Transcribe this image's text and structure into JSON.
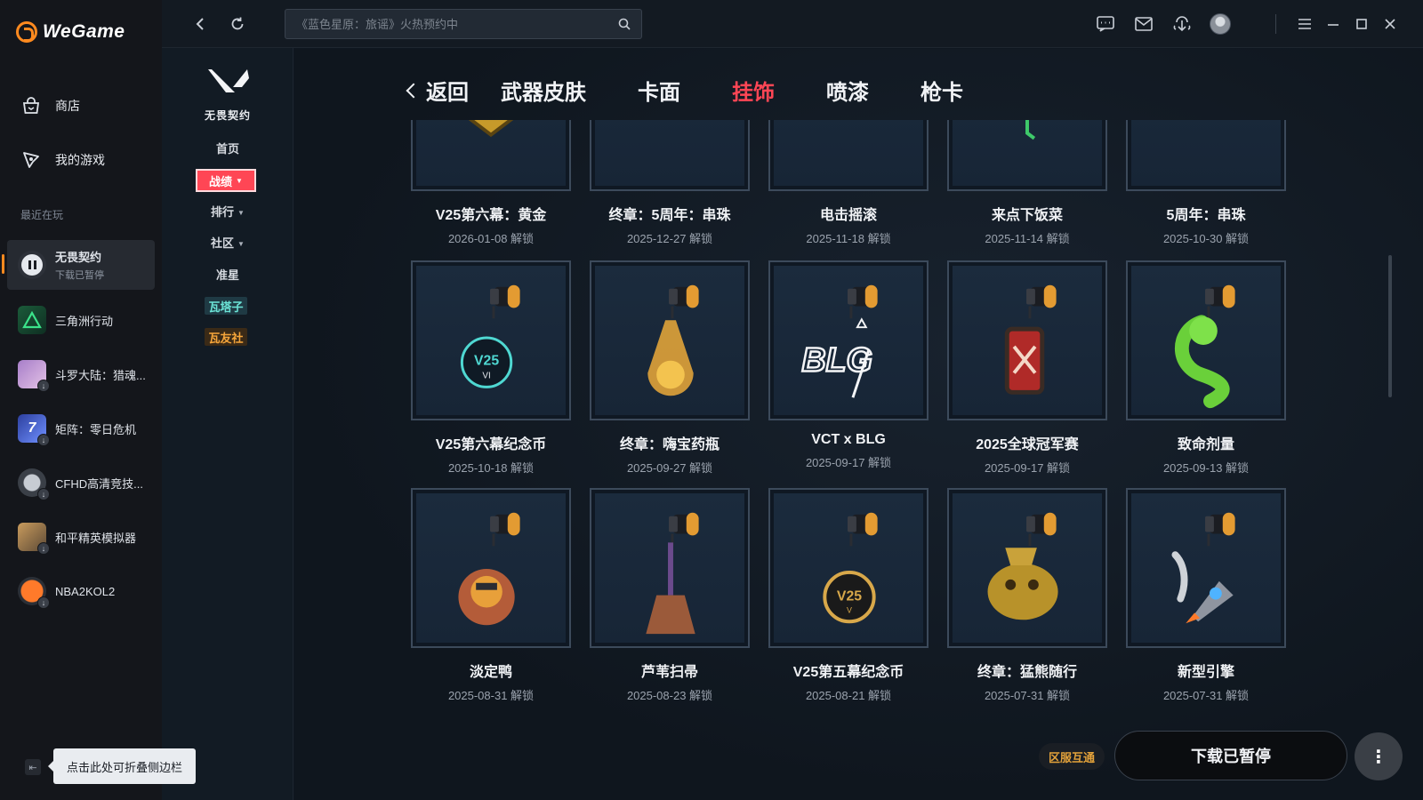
{
  "app": {
    "name": "WeGame"
  },
  "sidebar": {
    "nav": [
      {
        "label": "商店",
        "icon": "store-icon"
      },
      {
        "label": "我的游戏",
        "icon": "my-games-icon"
      }
    ],
    "recent_title": "最近在玩",
    "games": [
      {
        "name": "无畏契约",
        "sub": "下载已暂停",
        "active": true
      },
      {
        "name": "三角洲行动"
      },
      {
        "name": "斗罗大陆：猎魂..."
      },
      {
        "name": "矩阵：零日危机"
      },
      {
        "name": "CFHD高清竞技..."
      },
      {
        "name": "和平精英模拟器"
      },
      {
        "name": "NBA2KOL2"
      }
    ],
    "collapse_tooltip": "点击此处可折叠侧边栏"
  },
  "topbar": {
    "search_placeholder": "《蓝色星原：旅谣》火热预约中",
    "icons": [
      "chat-icon",
      "mail-icon",
      "download-manager-icon",
      "avatar",
      "menu-icon",
      "minimize-icon",
      "maximize-icon",
      "close-icon"
    ]
  },
  "game_nav": {
    "game_title": "无畏契约",
    "items": {
      "home": "首页",
      "record": "战绩",
      "rank": "排行",
      "community": "社区",
      "crosshair": "准星",
      "tag1": "瓦塔子",
      "tag2": "瓦友社"
    }
  },
  "tabs": {
    "back": "返回",
    "items": [
      {
        "label": "武器皮肤",
        "active": false
      },
      {
        "label": "卡面",
        "active": false
      },
      {
        "label": "挂饰",
        "active": true
      },
      {
        "label": "喷漆",
        "active": false
      },
      {
        "label": "枪卡",
        "active": false
      }
    ]
  },
  "unlock_suffix": "解锁",
  "items": [
    {
      "name": "V25第六幕：黄金",
      "date": "2026-01-08 解锁"
    },
    {
      "name": "终章：5周年：串珠",
      "date": "2025-12-27 解锁"
    },
    {
      "name": "电击摇滚",
      "date": "2025-11-18 解锁"
    },
    {
      "name": "来点下饭菜",
      "date": "2025-11-14 解锁"
    },
    {
      "name": "5周年：串珠",
      "date": "2025-10-30 解锁"
    },
    {
      "name": "V25第六幕纪念币",
      "date": "2025-10-18 解锁"
    },
    {
      "name": "终章：嗨宝药瓶",
      "date": "2025-09-27 解锁"
    },
    {
      "name": "VCT x BLG",
      "date": "2025-09-17 解锁"
    },
    {
      "name": "2025全球冠军赛",
      "date": "2025-09-17 解锁"
    },
    {
      "name": "致命剂量",
      "date": "2025-09-13 解锁"
    },
    {
      "name": "淡定鸭",
      "date": "2025-08-31 解锁"
    },
    {
      "name": "芦苇扫帚",
      "date": "2025-08-23 解锁"
    },
    {
      "name": "V25第五幕纪念币",
      "date": "2025-08-21 解锁"
    },
    {
      "name": "终章：猛熊随行",
      "date": "2025-07-31 解锁"
    },
    {
      "name": "新型引擎",
      "date": "2025-07-31 解锁"
    }
  ],
  "footer": {
    "region": "区服互通",
    "download_status": "下载已暂停",
    "more": "⋮"
  },
  "colors": {
    "accent": "#ff4655",
    "brand": "#ff8a1f"
  }
}
